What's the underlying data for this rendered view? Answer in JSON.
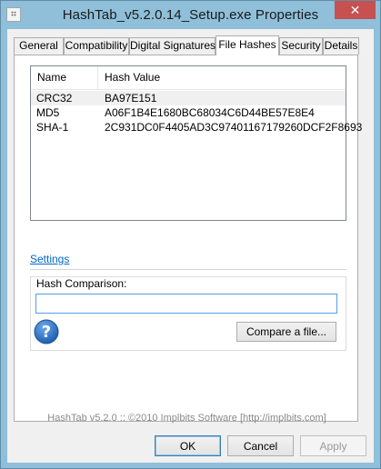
{
  "window": {
    "title": "HashTab_v5.2.0.14_Setup.exe Properties",
    "close_label": "✕"
  },
  "tabs": [
    {
      "label": "General"
    },
    {
      "label": "Compatibility"
    },
    {
      "label": "Digital Signatures"
    },
    {
      "label": "File Hashes",
      "active": true
    },
    {
      "label": "Security"
    },
    {
      "label": "Details"
    }
  ],
  "hash_list": {
    "columns": [
      "Name",
      "Hash Value"
    ],
    "rows": [
      {
        "name": "CRC32",
        "value": "BA97E151",
        "selected": true
      },
      {
        "name": "MD5",
        "value": "A06F1B4E1680BC68034C6D44BE57E8E4"
      },
      {
        "name": "SHA-1",
        "value": "2C931DC0F4405AD3C97401167179260DCF2F8693"
      }
    ]
  },
  "settings_link": "Settings",
  "comparison": {
    "label": "Hash Comparison:",
    "value": "",
    "compare_button": "Compare a file..."
  },
  "footer": "HashTab v5.2.0 :: ©2010 Implbits Software [http://implbits.com]",
  "buttons": {
    "ok": "OK",
    "cancel": "Cancel",
    "apply": "Apply"
  },
  "colors": {
    "frame": "#8fbfd9",
    "close": "#c75050",
    "link": "#0066cc",
    "help_icon": "#1c5fb0"
  },
  "icons": {
    "app": "app-window-icon",
    "help": "question-help-icon"
  }
}
